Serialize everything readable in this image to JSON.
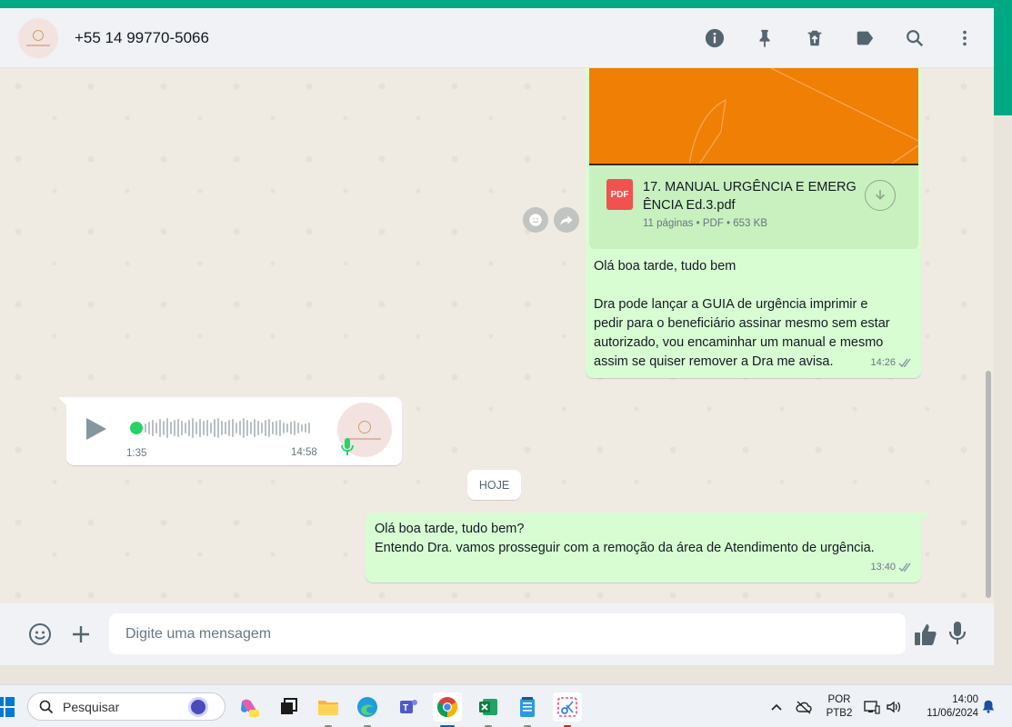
{
  "header": {
    "contact": "+55 14 99770-5066",
    "icons": [
      "info-icon",
      "pin-icon",
      "delete-icon",
      "label-icon",
      "search-icon",
      "menu-icon"
    ]
  },
  "document": {
    "name": "17. MANUAL URGÊNCIA E EMERGÊNCIA Ed.3.pdf",
    "name_line1": "17. MANUAL URGÊNCIA E EMERG",
    "name_line2": "ÊNCIA Ed.3.pdf",
    "pages": "11 páginas",
    "type": "PDF",
    "size": "653 KB",
    "icon_label": "PDF"
  },
  "message1": {
    "line1": "Olá boa tarde, tudo bem",
    "line2": "Dra pode lançar a GUIA de urgência imprimir e",
    "line3": "pedir para o beneficiário assinar mesmo sem estar",
    "line4": "autorizado, vou encaminhar um manual e mesmo",
    "line5": "assim se quiser remover a Dra me avisa.",
    "time": "14:26"
  },
  "audio": {
    "duration": "1:35",
    "time": "14:58"
  },
  "date_chip": "HOJE",
  "message2": {
    "line1": "Olá boa tarde, tudo bem?",
    "line2": "Entendo Dra. vamos prosseguir com a remoção da área de Atendimento de urgência.",
    "time": "13:40"
  },
  "composer": {
    "placeholder": "Digite uma mensagem"
  },
  "taskbar": {
    "search_label": "Pesquisar",
    "language": "POR",
    "layout": "PTB2",
    "time": "14:00",
    "date": "11/06/2024"
  },
  "colors": {
    "accent": "#00a884",
    "outgoing_bubble": "#d9fdd3",
    "chat_bg": "#efeae2"
  }
}
